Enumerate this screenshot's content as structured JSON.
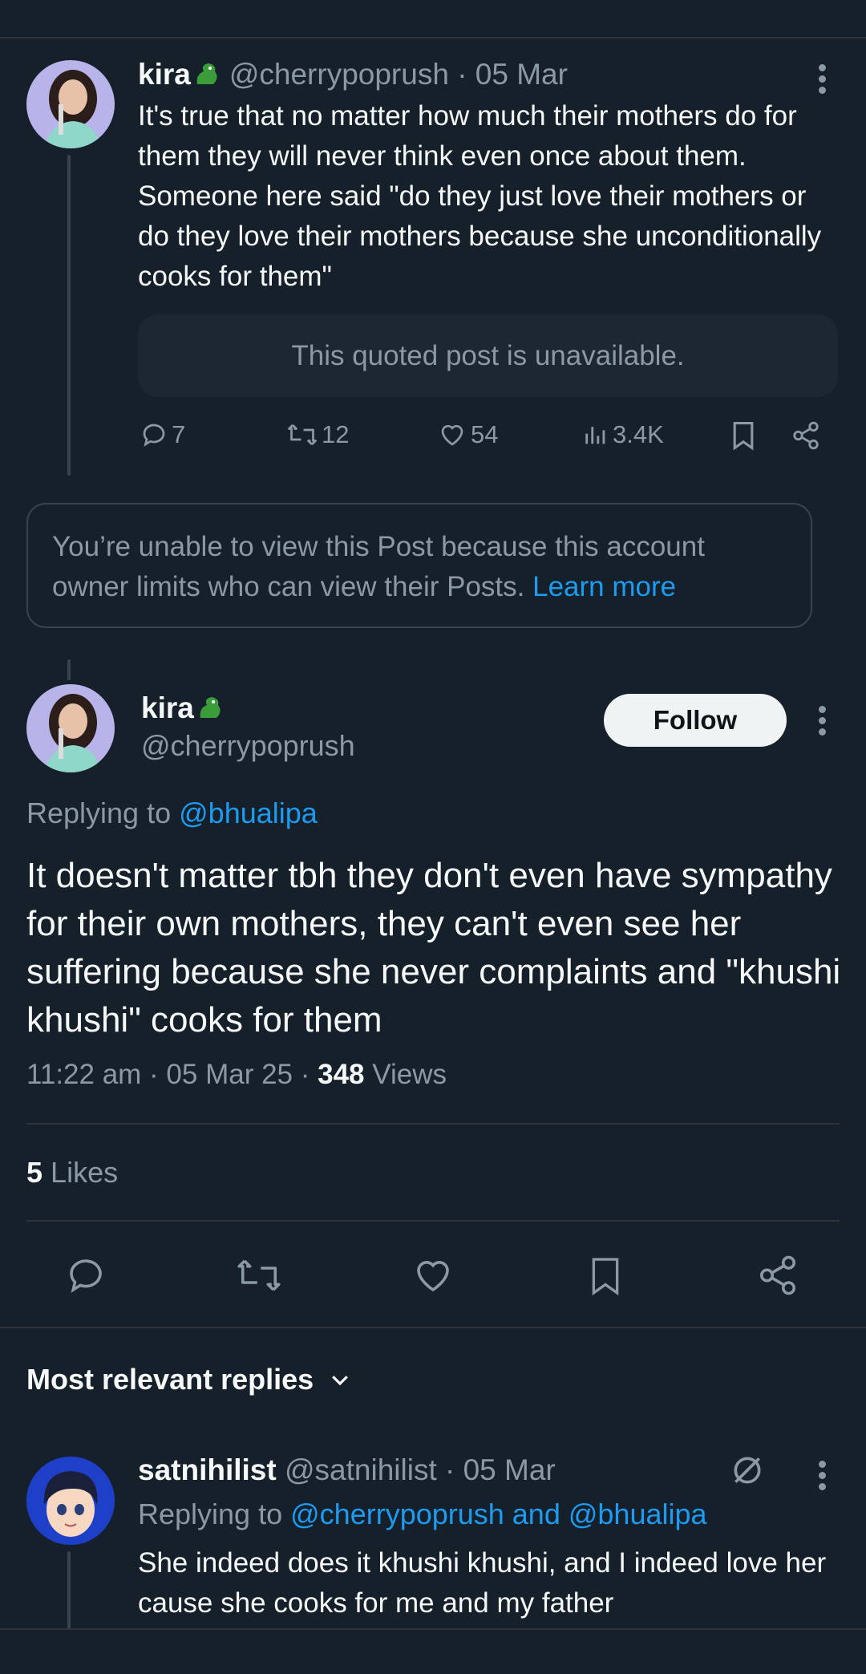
{
  "colors": {
    "background": "#15202b",
    "link": "#1d9bf0",
    "muted": "#8b98a5",
    "text": "#f7f9f9"
  },
  "parent_post": {
    "display_name": "kira",
    "handle_meta": "@cherrypoprush · 05 Mar",
    "text": "It's true that no matter how much their mothers do for them they will never think even once about them. Someone here said \"do they just love their mothers or do they love their mothers because she unconditionally cooks for them\"",
    "quoted_unavailable": "This quoted post is unavailable.",
    "stats": {
      "replies": "7",
      "reposts": "12",
      "likes": "54",
      "views": "3.4K"
    }
  },
  "restricted_notice": {
    "text": "You’re unable to view this Post because this account owner limits who can view their Posts.",
    "link": "Learn more"
  },
  "main_post": {
    "display_name": "kira",
    "handle": "@cherrypoprush",
    "follow_label": "Follow",
    "replying_prefix": "Replying to",
    "replying_handle": "@bhualipa",
    "text": "It doesn't matter tbh they don't even have sympathy for their own mothers, they can't even see her suffering because she never complaints and \"khushi khushi\" cooks for them",
    "timestamp": "11:22 am · 05 Mar 25 · ",
    "views_count": "348",
    "views_label": "Views",
    "likes_count": "5",
    "likes_label": "Likes"
  },
  "replies_header": "Most relevant replies",
  "reply": {
    "display_name": "satnihilist",
    "handle_meta": "@satnihilist · 05 Mar",
    "replying_prefix": "Replying to",
    "replying_handles": "@cherrypoprush and @bhualipa",
    "text": "She indeed does it khushi khushi, and I indeed love her cause she cooks for me and my father"
  }
}
